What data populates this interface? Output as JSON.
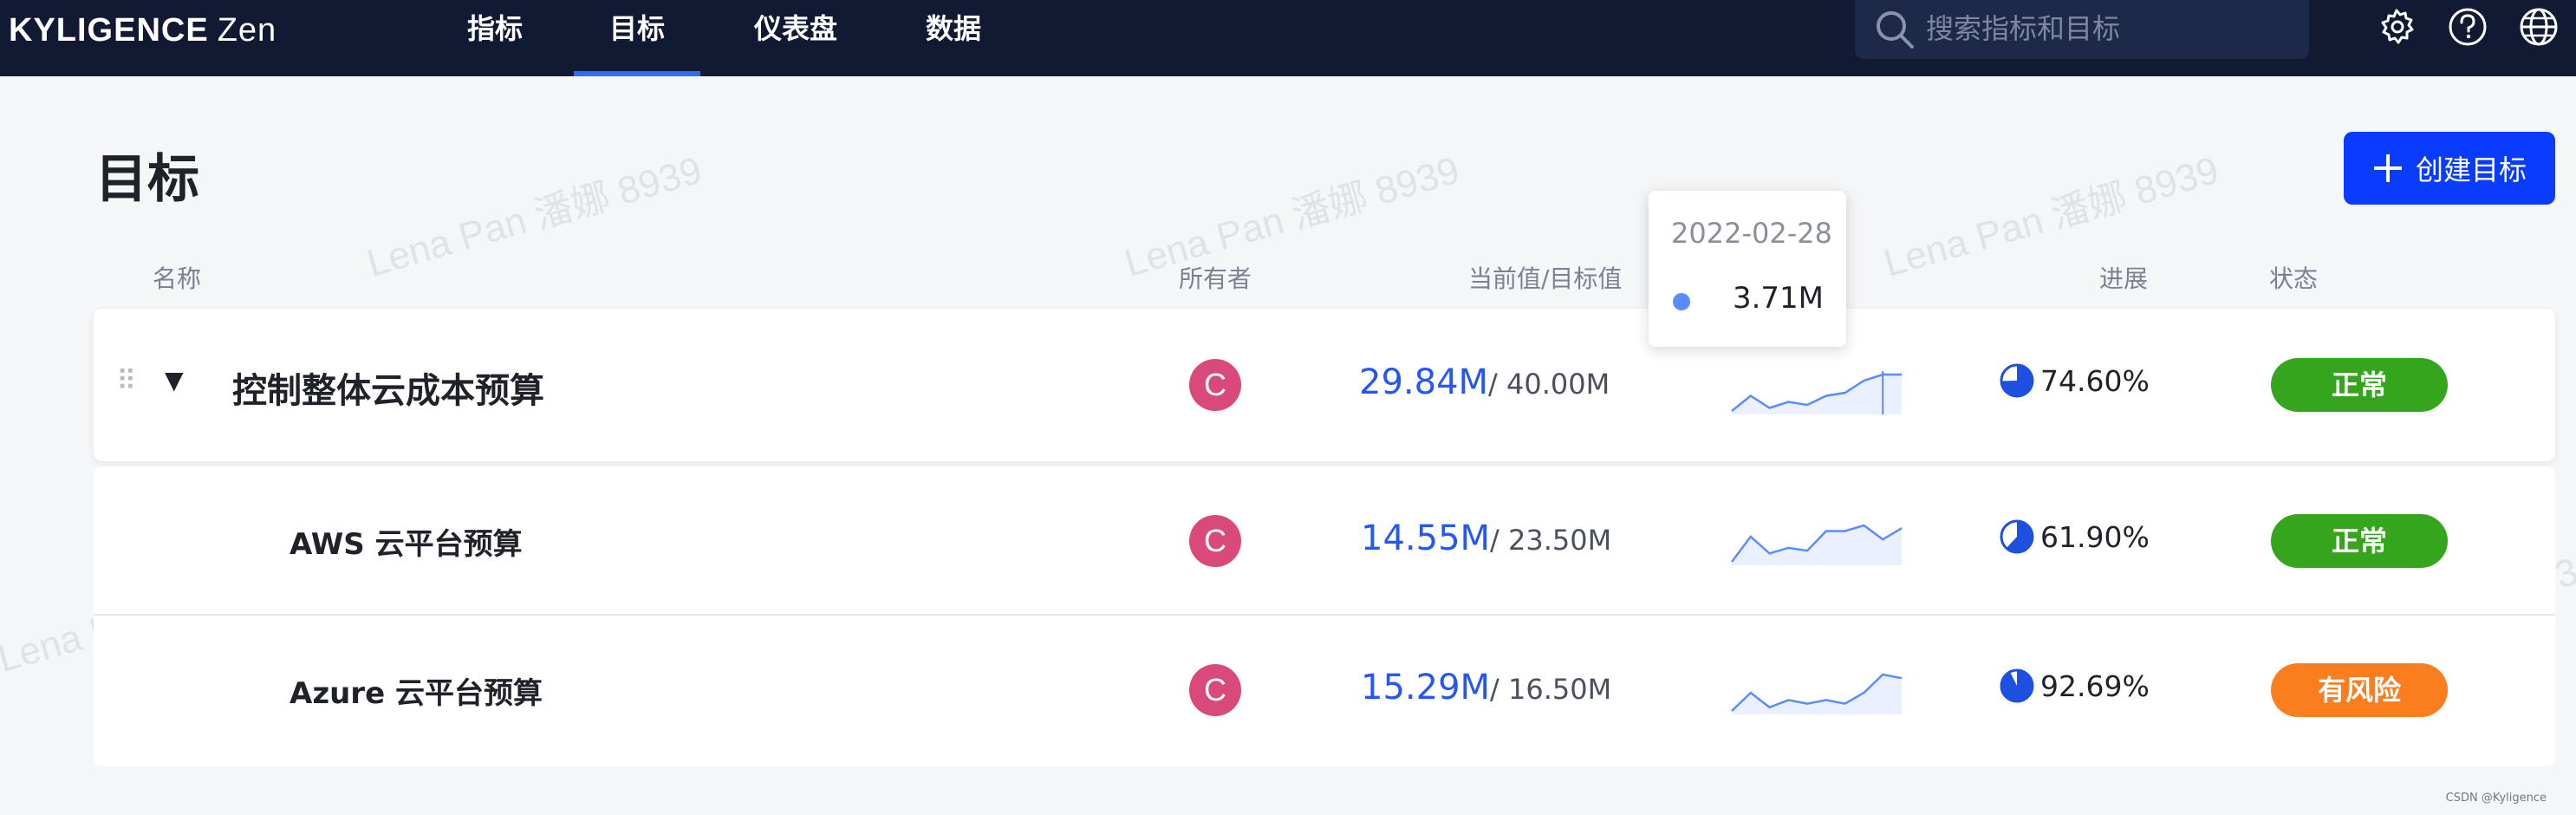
{
  "topbar": {
    "logo_brand": "KYLIGENCE",
    "logo_product": "Zen",
    "nav": [
      "指标",
      "目标",
      "仪表盘",
      "数据"
    ],
    "active_nav": "目标",
    "search_placeholder": "搜索指标和目标",
    "icons": [
      "settings-icon",
      "help-icon",
      "globe-icon"
    ]
  },
  "page": {
    "title": "目标",
    "create_button": "创建目标",
    "watermark": "Lena Pan 潘娜 8939"
  },
  "table": {
    "columns": {
      "name": "名称",
      "owner": "所有者",
      "value": "当前值/目标值",
      "progress": "进展",
      "status": "状态"
    },
    "rows": [
      {
        "name": "控制整体云成本预算",
        "owner_initial": "C",
        "current": "29.84M",
        "target": "/ 40.00M",
        "progress": "74.60%",
        "progress_fraction": 0.746,
        "status": "正常",
        "status_color": "#35a51e",
        "trend": [
          3,
          8,
          4,
          6,
          5,
          8,
          9,
          13,
          15,
          15
        ]
      },
      {
        "name": "AWS 云平台预算",
        "owner_initial": "C",
        "current": "14.55M",
        "target": "/ 23.50M",
        "progress": "61.90%",
        "progress_fraction": 0.619,
        "status": "正常",
        "status_color": "#35a51e",
        "trend": [
          3,
          12,
          6,
          8,
          7,
          14,
          14,
          16,
          11,
          15
        ]
      },
      {
        "name": "Azure 云平台预算",
        "owner_initial": "C",
        "current": "15.29M",
        "target": "/ 16.50M",
        "progress": "92.69%",
        "progress_fraction": 0.9269,
        "status": "有风险",
        "status_color": "#fa7d1e",
        "trend": [
          4,
          9,
          5,
          7,
          6,
          7,
          6,
          9,
          14,
          13
        ]
      }
    ]
  },
  "tooltip": {
    "date": "2022-02-28",
    "value": "3.71M"
  },
  "credit": "CSDN @Kyligence"
}
